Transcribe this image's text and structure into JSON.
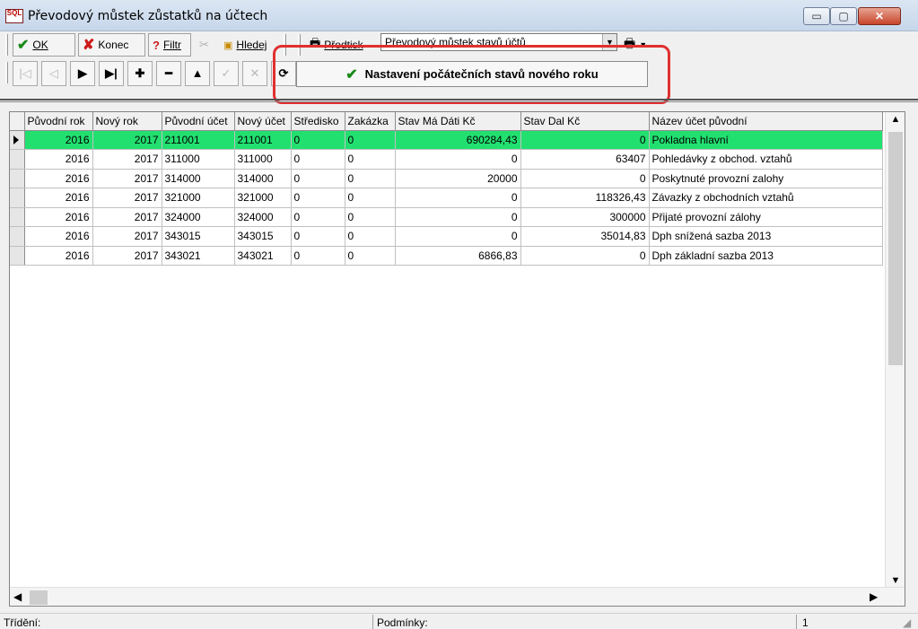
{
  "window": {
    "app_icon_text": "SQL",
    "title": "Převodový můstek zůstatků na účtech",
    "minimize": "▭",
    "maximize": "▢",
    "close": "✕"
  },
  "toolbar": {
    "ok_label": "OK",
    "konec_label": "Konec",
    "filtr_label": "Filtr",
    "hledej_label": "Hledej",
    "predtisk_label": "Předtisk",
    "report_select_value": "Převodový můstek stavů účtů"
  },
  "action": {
    "set_initial_label": "Nastavení počátečních stavů nového roku"
  },
  "grid": {
    "columns": [
      "Původní rok",
      "Nový rok",
      "Původní účet",
      "Nový účet",
      "Středisko",
      "Zakázka",
      "Stav Má Dáti Kč",
      "Stav Dal Kč",
      "Název účet původní"
    ],
    "rows": [
      [
        "2016",
        "2017",
        "211001",
        "211001",
        "0",
        "0",
        "690284,43",
        "0",
        "Pokladna hlavní"
      ],
      [
        "2016",
        "2017",
        "311000",
        "311000",
        "0",
        "0",
        "0",
        "63407",
        "Pohledávky z obchod. vztahů"
      ],
      [
        "2016",
        "2017",
        "314000",
        "314000",
        "0",
        "0",
        "20000",
        "0",
        "Poskytnuté provozní zalohy"
      ],
      [
        "2016",
        "2017",
        "321000",
        "321000",
        "0",
        "0",
        "0",
        "118326,43",
        "Závazky z obchodních vztahů"
      ],
      [
        "2016",
        "2017",
        "324000",
        "324000",
        "0",
        "0",
        "0",
        "300000",
        "Přijaté provozní zálohy"
      ],
      [
        "2016",
        "2017",
        "343015",
        "343015",
        "0",
        "0",
        "0",
        "35014,83",
        "Dph snížená sazba 2013"
      ],
      [
        "2016",
        "2017",
        "343021",
        "343021",
        "0",
        "0",
        "6866,83",
        "0",
        "Dph základní sazba 2013"
      ]
    ]
  },
  "status": {
    "trideni_label": "Třídění:",
    "podminky_label": "Podmínky:",
    "count": "1"
  },
  "colors": {
    "selected_row": "#22e070",
    "highlight_border": "#e03030"
  }
}
